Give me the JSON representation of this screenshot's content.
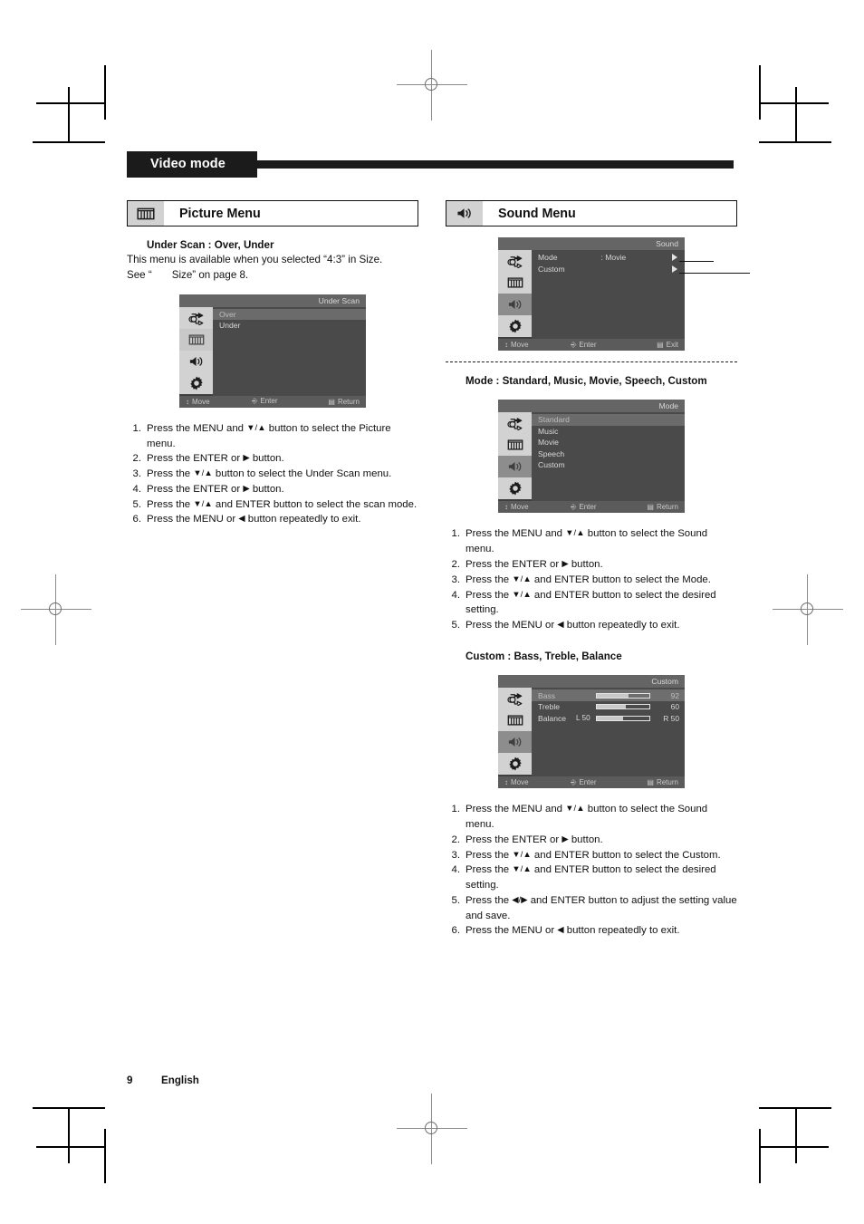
{
  "page": {
    "band_label": "Video mode",
    "footer_page": "9",
    "footer_language": "English"
  },
  "left_column": {
    "menu_header": {
      "icon": "picture-bars-icon",
      "title": "Picture Menu"
    },
    "subhead": "Under Scan : Over, Under",
    "paragraph_line1": "This menu is available when you selected “4:3” in Size.",
    "paragraph_line2_a": "See “",
    "paragraph_line2_b": "Size” on page 8.",
    "osd": {
      "title": "Under Scan",
      "rail": [
        "source-plug-icon",
        "picture-bars-icon",
        "speaker-icon",
        "gear-icon"
      ],
      "rail_active_index": 1,
      "items": [
        {
          "label": "Over",
          "selected": true
        },
        {
          "label": "Under",
          "selected": false
        }
      ],
      "footer": {
        "move": "Move",
        "enter": "Enter",
        "exit": "Return"
      }
    },
    "steps": [
      {
        "num": "1.",
        "text_a": "Press the MENU and ",
        "glyph": "▼/▲",
        "text_b": " button to select the Picture menu."
      },
      {
        "num": "2.",
        "text_a": "Press the ENTER or ",
        "glyph": "▶",
        "text_b": " button."
      },
      {
        "num": "3.",
        "text_a": "Press the ",
        "glyph": "▼/▲",
        "text_b": " button to select the Under Scan menu."
      },
      {
        "num": "4.",
        "text_a": "Press the ENTER or ",
        "glyph": "▶",
        "text_b": " button."
      },
      {
        "num": "5.",
        "text_a": "Press the ",
        "glyph": "▼/▲",
        "text_b": " and ENTER button to select the scan mode."
      },
      {
        "num": "6.",
        "text_a": "Press the MENU or ",
        "glyph": "◀",
        "text_b": " button repeatedly to exit."
      }
    ]
  },
  "right_column": {
    "menu_header": {
      "icon": "speaker-icon",
      "title": "Sound Menu"
    },
    "sound_osd": {
      "title": "Sound",
      "rail": [
        "source-plug-icon",
        "picture-bars-icon",
        "speaker-icon",
        "gear-icon"
      ],
      "rail_active_index": 2,
      "items": [
        {
          "label": "Mode",
          "value": ": Movie",
          "caret": true
        },
        {
          "label": "Custom",
          "value": "",
          "caret": true
        }
      ],
      "footer": {
        "move": "Move",
        "enter": "Enter",
        "exit": "Exit"
      }
    },
    "mode_subhead": "Mode : Standard, Music, Movie, Speech, Custom",
    "mode_osd": {
      "title": "Mode",
      "rail": [
        "source-plug-icon",
        "picture-bars-icon",
        "speaker-icon",
        "gear-icon"
      ],
      "rail_active_index": 2,
      "items": [
        {
          "label": "Standard",
          "selected": true
        },
        {
          "label": "Music",
          "selected": false
        },
        {
          "label": "Movie",
          "selected": false
        },
        {
          "label": "Speech",
          "selected": false
        },
        {
          "label": "Custom",
          "selected": false
        }
      ],
      "footer": {
        "move": "Move",
        "enter": "Enter",
        "exit": "Return"
      }
    },
    "mode_steps": [
      {
        "num": "1.",
        "text_a": "Press the MENU and ",
        "glyph": "▼/▲",
        "text_b": " button to select the Sound menu."
      },
      {
        "num": "2.",
        "text_a": "Press the ENTER or ",
        "glyph": "▶",
        "text_b": " button."
      },
      {
        "num": "3.",
        "text_a": "Press the ",
        "glyph": "▼/▲",
        "text_b": " and ENTER button to select the Mode."
      },
      {
        "num": "4.",
        "text_a": "Press the ",
        "glyph": "▼/▲",
        "text_b": " and ENTER button to select the desired setting."
      },
      {
        "num": "5.",
        "text_a": "Press the MENU or ",
        "glyph": "◀",
        "text_b": " button repeatedly to exit."
      }
    ],
    "custom_subhead": "Custom : Bass, Treble, Balance",
    "custom_osd": {
      "title": "Custom",
      "rail": [
        "source-plug-icon",
        "picture-bars-icon",
        "speaker-icon",
        "gear-icon"
      ],
      "rail_active_index": 2,
      "sliders": [
        {
          "label": "Bass",
          "prefix": "",
          "fill_pct": 60,
          "value": "92",
          "selected": true
        },
        {
          "label": "Treble",
          "prefix": "",
          "fill_pct": 55,
          "value": "60",
          "selected": false
        },
        {
          "label": "Balance",
          "prefix": "L 50",
          "fill_pct": 50,
          "value": "R 50",
          "selected": false
        }
      ],
      "footer": {
        "move": "Move",
        "enter": "Enter",
        "exit": "Return"
      }
    },
    "custom_steps": [
      {
        "num": "1.",
        "text_a": "Press the MENU and ",
        "glyph": "▼/▲",
        "text_b": " button to select the Sound menu."
      },
      {
        "num": "2.",
        "text_a": "Press the ENTER or ",
        "glyph": "▶",
        "text_b": " button."
      },
      {
        "num": "3.",
        "text_a": "Press the ",
        "glyph": "▼/▲",
        "text_b": " and ENTER button to select the Custom."
      },
      {
        "num": "4.",
        "text_a": "Press the ",
        "glyph": "▼/▲",
        "text_b": " and ENTER button to select the desired setting."
      },
      {
        "num": "5.",
        "text_a": "Press the ",
        "glyph": "◀/▶",
        "text_b": " and ENTER button to adjust the setting value and save."
      },
      {
        "num": "6.",
        "text_a": "Press the MENU or ",
        "glyph": "◀",
        "text_b": " button repeatedly to exit."
      }
    ]
  }
}
